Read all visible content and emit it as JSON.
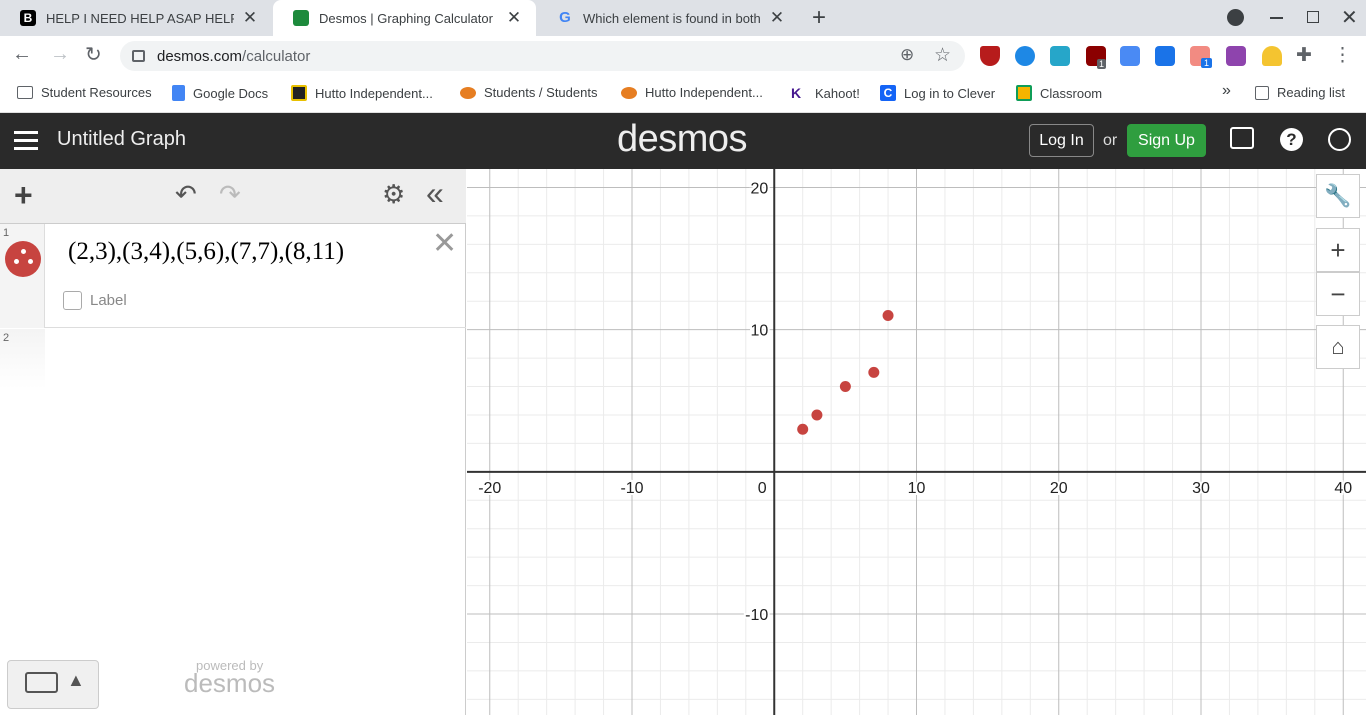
{
  "browser": {
    "tabs": [
      {
        "title": "HELP I NEED HELP ASAP HELP I",
        "favicon": "brainly-icon"
      },
      {
        "title": "Desmos | Graphing Calculator",
        "favicon": "desmos-icon"
      },
      {
        "title": "Which element is found in both D",
        "favicon": "google-icon"
      }
    ],
    "new_tab_symbol": "+",
    "url_host": "desmos.com",
    "url_path": "/calculator",
    "bookmarks": [
      {
        "label": "Student Resources"
      },
      {
        "label": "Google Docs"
      },
      {
        "label": "Hutto Independent..."
      },
      {
        "label": "Students / Students"
      },
      {
        "label": "Hutto Independent..."
      },
      {
        "label": "Kahoot!"
      },
      {
        "label": "Log in to Clever"
      },
      {
        "label": "Classroom"
      }
    ],
    "more_bookmarks": "»",
    "reading_list": "Reading list",
    "extension_badge_1": "1",
    "extension_badge_2": "1"
  },
  "desmos": {
    "graph_title": "Untitled Graph",
    "logo": "desmos",
    "login_label": "Log In",
    "or_text": "or",
    "signup_label": "Sign Up",
    "expressions": [
      {
        "index": "1",
        "latex": "(2,3),(3,4),(5,6),(7,7),(8,11)",
        "label_checkbox": "Label",
        "color": "#c74440"
      },
      {
        "index": "2",
        "latex": ""
      }
    ],
    "powered_by": "powered by",
    "powered_logo": "desmos"
  },
  "colors": {
    "accent_green": "#2f9e3f",
    "point_red": "#c74440",
    "header_bg": "#2a2a2a"
  },
  "chart_data": {
    "type": "scatter",
    "points": [
      {
        "x": 2,
        "y": 3
      },
      {
        "x": 3,
        "y": 4
      },
      {
        "x": 5,
        "y": 6
      },
      {
        "x": 7,
        "y": 7
      },
      {
        "x": 8,
        "y": 11
      }
    ],
    "xlim": [
      -21.6,
      41.6
    ],
    "ylim": [
      -17.1,
      21.3
    ],
    "x_ticks": [
      -20,
      -10,
      0,
      10,
      20,
      30,
      40
    ],
    "y_ticks": [
      20,
      10,
      -10
    ],
    "grid": true,
    "minor_step": 2
  }
}
